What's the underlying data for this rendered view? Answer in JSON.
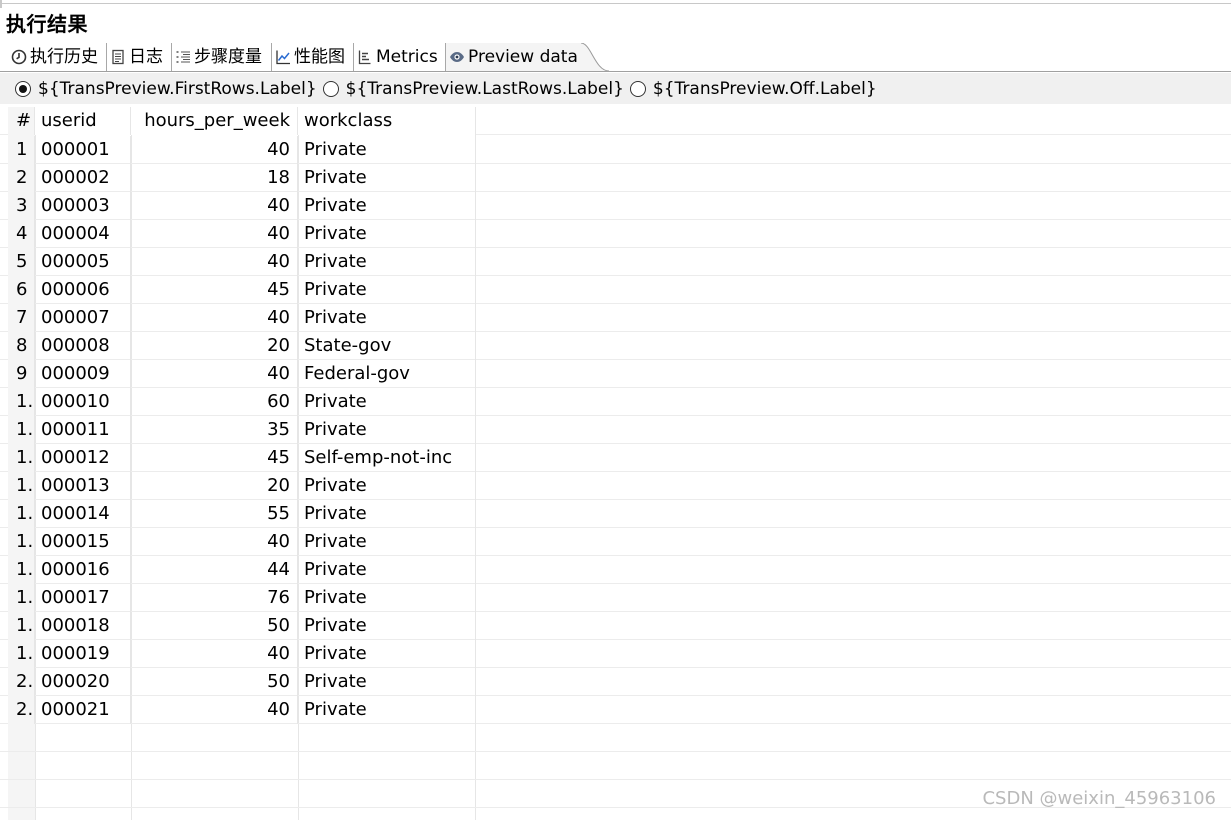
{
  "panel": {
    "title": "执行结果"
  },
  "tabs": [
    {
      "label": "执行历史",
      "icon": "clock-icon"
    },
    {
      "label": "日志",
      "icon": "log-document-icon"
    },
    {
      "label": "步骤度量",
      "icon": "step-metrics-list-icon"
    },
    {
      "label": "性能图",
      "icon": "performance-chart-icon"
    },
    {
      "label": "Metrics",
      "icon": "metrics-icon"
    },
    {
      "label": "Preview data",
      "icon": "eye-icon",
      "active": true
    }
  ],
  "preview_mode": {
    "options": [
      {
        "label": "${TransPreview.FirstRows.Label}",
        "checked": true
      },
      {
        "label": "${TransPreview.LastRows.Label}",
        "checked": false
      },
      {
        "label": "${TransPreview.Off.Label}",
        "checked": false
      }
    ]
  },
  "table": {
    "columns": [
      "#",
      "userid",
      "hours_per_week",
      "workclass"
    ],
    "rows": [
      [
        "1",
        "000001",
        "40",
        "Private"
      ],
      [
        "2",
        "000002",
        "18",
        "Private"
      ],
      [
        "3",
        "000003",
        "40",
        "Private"
      ],
      [
        "4",
        "000004",
        "40",
        "Private"
      ],
      [
        "5",
        "000005",
        "40",
        "Private"
      ],
      [
        "6",
        "000006",
        "45",
        "Private"
      ],
      [
        "7",
        "000007",
        "40",
        "Private"
      ],
      [
        "8",
        "000008",
        "20",
        "State-gov"
      ],
      [
        "9",
        "000009",
        "40",
        "Federal-gov"
      ],
      [
        "1.",
        "000010",
        "60",
        "Private"
      ],
      [
        "1.",
        "000011",
        "35",
        "Private"
      ],
      [
        "1.",
        "000012",
        "45",
        "Self-emp-not-inc"
      ],
      [
        "1.",
        "000013",
        "20",
        "Private"
      ],
      [
        "1.",
        "000014",
        "55",
        "Private"
      ],
      [
        "1.",
        "000015",
        "40",
        "Private"
      ],
      [
        "1.",
        "000016",
        "44",
        "Private"
      ],
      [
        "1.",
        "000017",
        "76",
        "Private"
      ],
      [
        "1.",
        "000018",
        "50",
        "Private"
      ],
      [
        "1.",
        "000019",
        "40",
        "Private"
      ],
      [
        "2.",
        "000020",
        "50",
        "Private"
      ],
      [
        "2.",
        "000021",
        "40",
        "Private"
      ]
    ]
  },
  "watermark": "CSDN @weixin_45963106"
}
